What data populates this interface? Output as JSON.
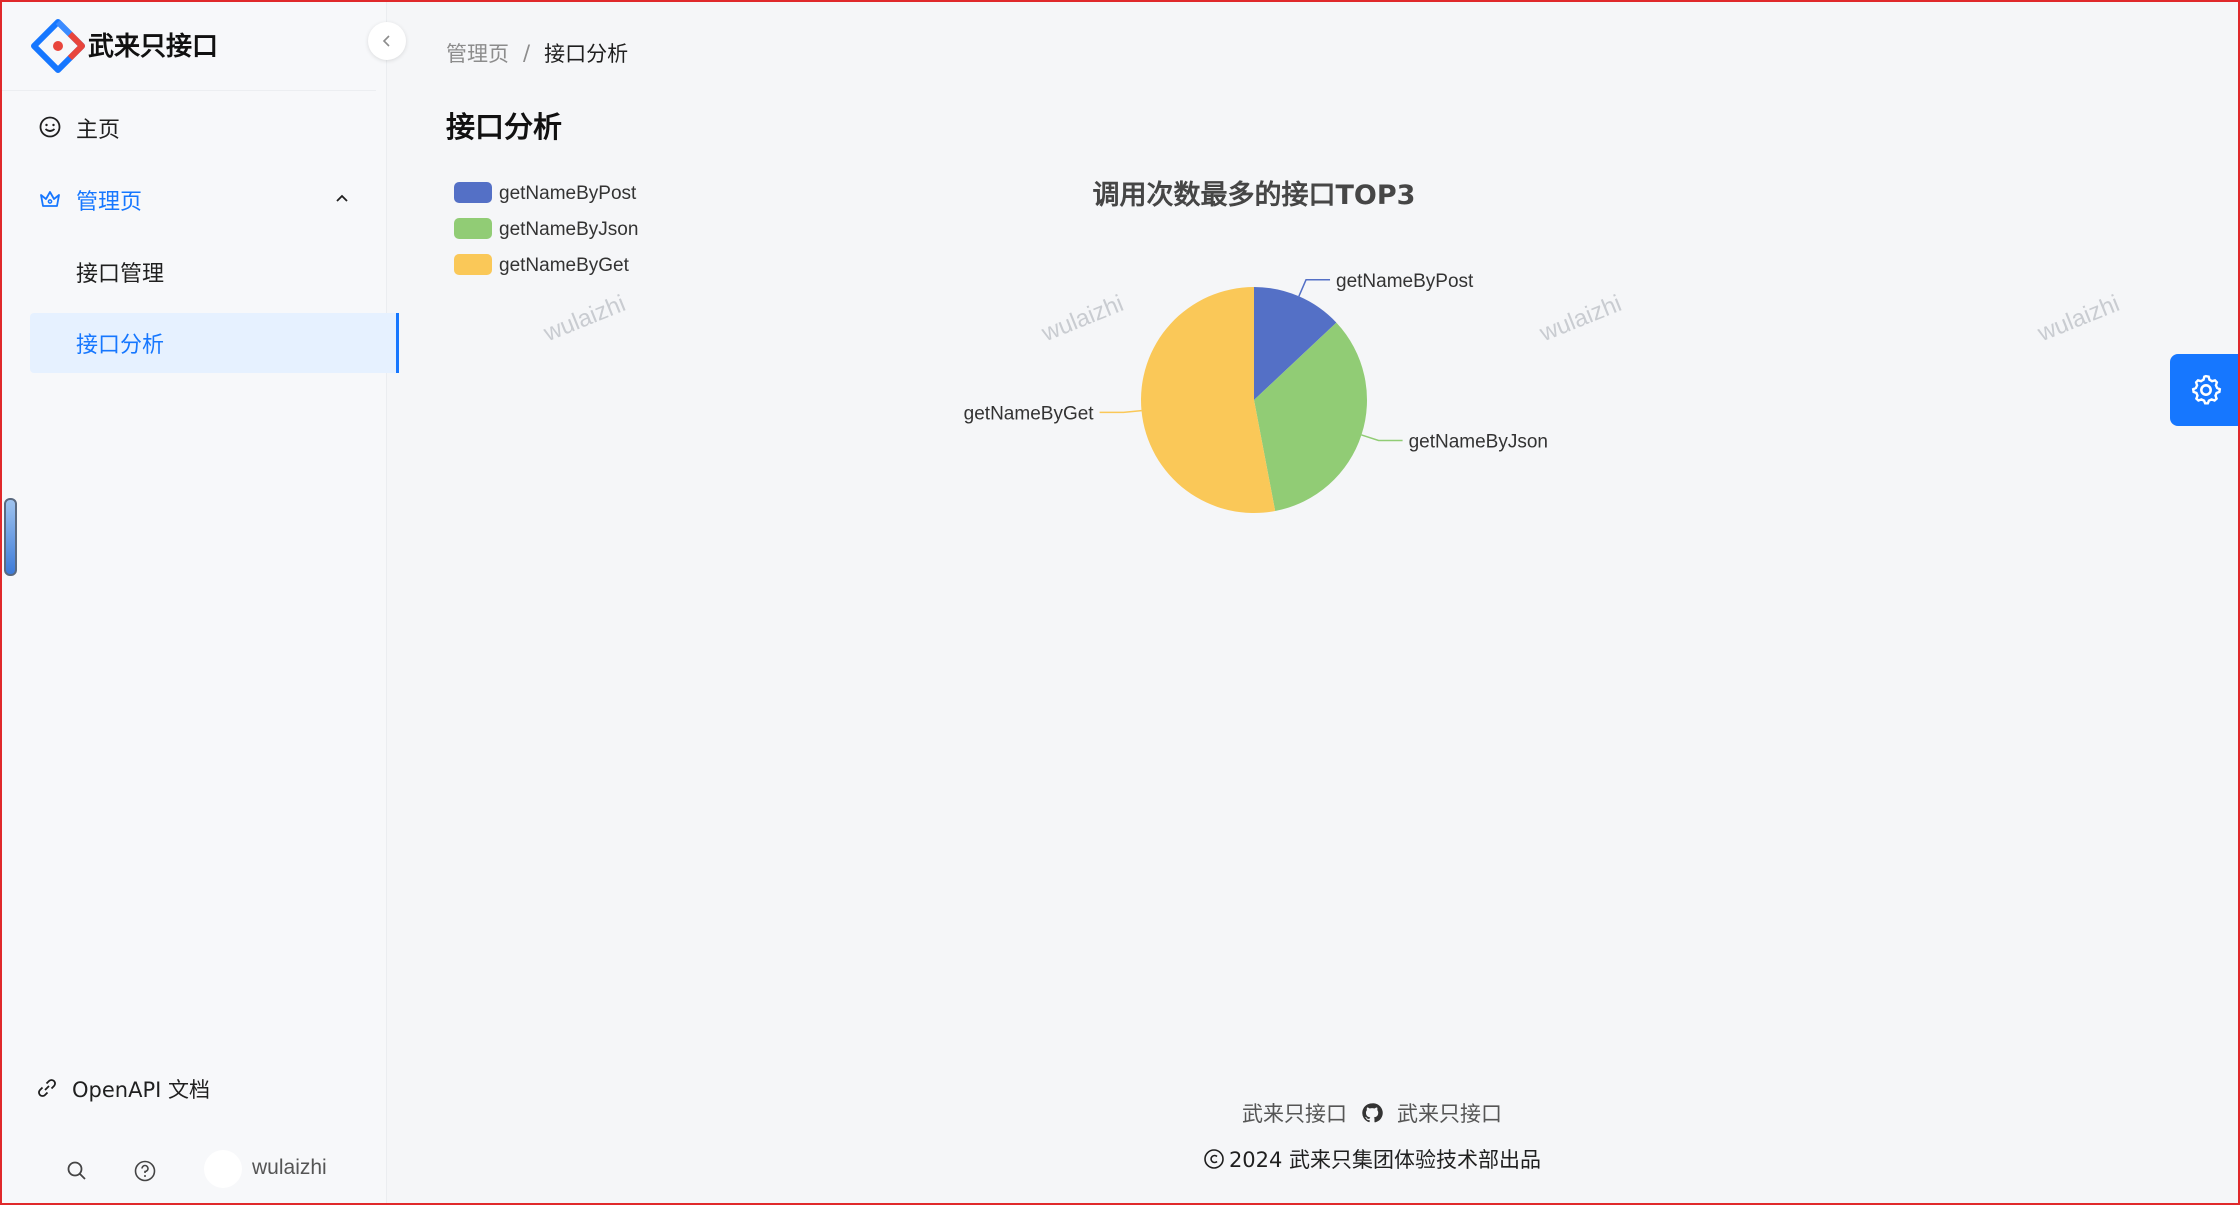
{
  "app": {
    "title": "武来只接口"
  },
  "sidebar": {
    "items": [
      {
        "label": "主页",
        "icon": "smile-icon"
      },
      {
        "label": "管理页",
        "icon": "crown-icon",
        "expanded": true,
        "children": [
          {
            "label": "接口管理"
          },
          {
            "label": "接口分析",
            "active": true
          }
        ]
      }
    ],
    "openapi_label": "OpenAPI 文档",
    "username": "wulaizhi"
  },
  "breadcrumb": {
    "parent": "管理页",
    "separator": "/",
    "current": "接口分析"
  },
  "page": {
    "title": "接口分析"
  },
  "watermark_text": "wulaizhi",
  "chart_data": {
    "type": "pie",
    "title": "调用次数最多的接口TOP3",
    "legend_position": "top-left",
    "series": [
      {
        "name": "getNameByPost",
        "value": 13,
        "color": "#5470c6"
      },
      {
        "name": "getNameByJson",
        "value": 34,
        "color": "#91cc75"
      },
      {
        "name": "getNameByGet",
        "value": 53,
        "color": "#fac858"
      }
    ]
  },
  "footer": {
    "link1": "武来只接口",
    "link2": "武来只接口",
    "copyright": "2024 武来只集团体验技术部出品"
  },
  "colors": {
    "accent": "#1677ff",
    "active_bg": "#e6f1ff"
  }
}
